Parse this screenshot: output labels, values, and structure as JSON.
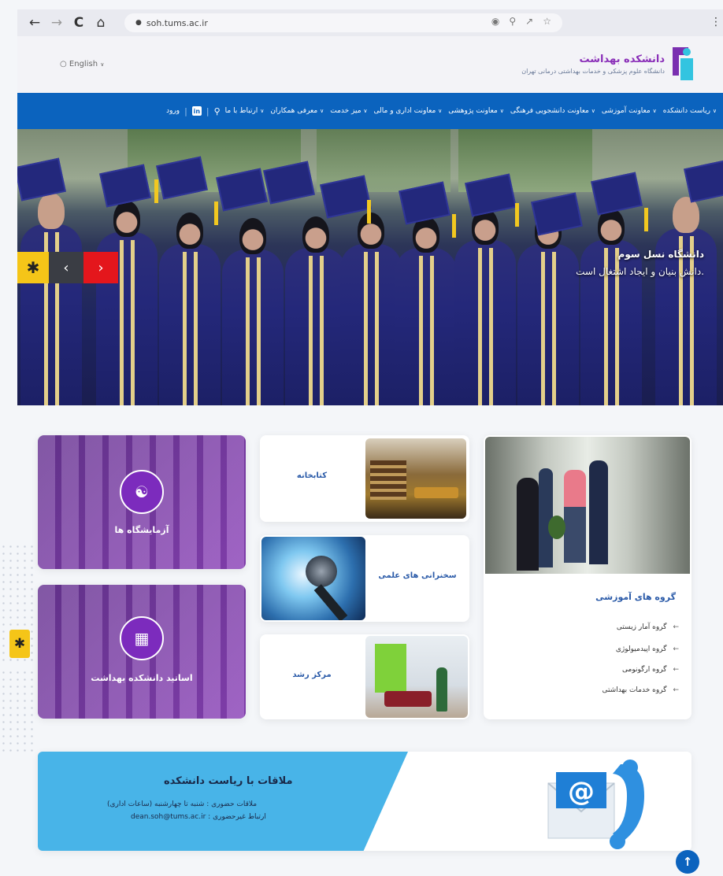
{
  "browser": {
    "url": "soh.tums.ac.ir",
    "back": "←",
    "forward": "→",
    "reload": "C",
    "home": "⌂",
    "lock": "🔒",
    "more": "⋮"
  },
  "header": {
    "lang_label": "English",
    "brand_title": "دانشکده بهداشت",
    "brand_subtitle": "دانشگاه علوم پزشکی و خدمات بهداشتی درمانی تهران"
  },
  "nav": {
    "items": [
      "ریاست دانشکده",
      "معاونت آموزشی",
      "معاونت دانشجویی فرهنگی",
      "معاونت پژوهشی",
      "معاونت اداری و مالی",
      "میز خدمت",
      "معرفی همکاران",
      "ارتباط با ما"
    ],
    "login": "ورود",
    "linkedin": "in"
  },
  "hero": {
    "caption_line1": "دانشگاه نسل سوم",
    "caption_line2": "دانش بنیان و ایجاد اشتغال است."
  },
  "cards": {
    "labs": "آزمایشگاه ها",
    "faculty": "اساتید دانشکده بهداشت",
    "library": "کتابخانه",
    "lectures": "سخنرانی های علمی",
    "growth_center": "مرکز رشد"
  },
  "groups": {
    "title": "گروه های آموزشی",
    "items": [
      "گروه آمار زیستی",
      "گروه اپیدمیولوژی",
      "گروه ارگونومی",
      "گروه خدمات بهداشتی"
    ]
  },
  "banner": {
    "title": "ملاقات با ریاست دانشکده",
    "line1": "ملاقات حضوری : شنبه تا چهارشنبه (ساعات اداری)",
    "line2": "dean.soh@tums.ac.ir : ارتباط غیرحضوری"
  },
  "colors": {
    "nav_blue": "#0b63be",
    "brand_purple": "#8a2fb8",
    "banner_blue": "#48b4e8",
    "accent_yellow": "#f5c518",
    "slider_red": "#e4161c"
  }
}
